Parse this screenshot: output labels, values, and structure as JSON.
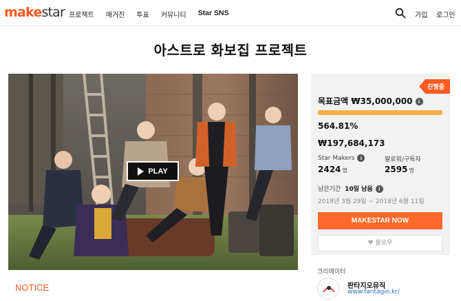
{
  "brand": {
    "logo_make": "make",
    "logo_star": "star",
    "accent_color": "#ff5a1f"
  },
  "nav": {
    "items": [
      "프로젝트",
      "매거진",
      "투표",
      "커뮤니티",
      "Star SNS"
    ],
    "search_icon": "search-icon",
    "signup_label": "가입",
    "login_label": "로그인"
  },
  "project": {
    "title": "아스트로 화보집 프로젝트",
    "play_label": "PLAY",
    "notice_label": "NOTICE"
  },
  "panel": {
    "status_badge": "진행중",
    "goal_label": "목표금액 ₩35,000,000",
    "progress_fraction": 1.0,
    "percent_text": "564.81%",
    "amount_text": "₩197,684,173",
    "makers_label": "Star Makers",
    "makers_value": "2424",
    "makers_unit": "명",
    "followers_label": "팔로워/구독자",
    "followers_value": "2595",
    "followers_unit": "명",
    "remain_label": "남은기간",
    "remain_value": "10일 남음",
    "date_range": "2018년 3월 29일 ~ 2018년 6월 11일",
    "cta_label": "MAKESTAR NOW",
    "follow_label": "팔로우"
  },
  "creator": {
    "section_label": "크리에이터",
    "name": "판타지오뮤직",
    "url": "www.fantagio.kr/"
  }
}
